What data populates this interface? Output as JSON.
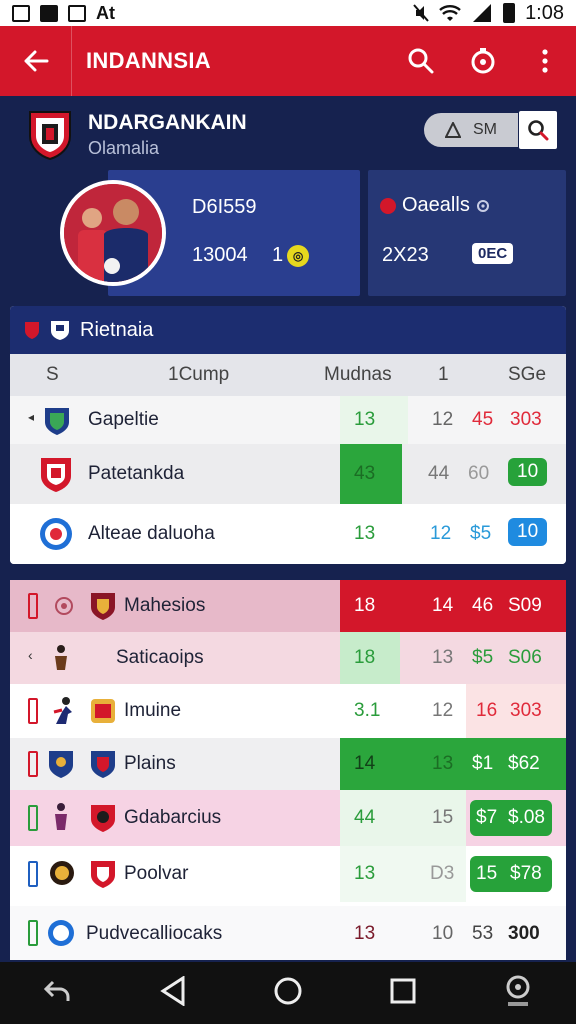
{
  "status_bar": {
    "left_text": "At",
    "time": "1:08"
  },
  "app_bar": {
    "title": "INDANNSIA"
  },
  "team": {
    "name": "NDARGANKAIN",
    "subtitle": "Olamalia",
    "search_label": "SM"
  },
  "player_card": {
    "value_1": "D6I559",
    "value_2": "13004",
    "value_3": "1"
  },
  "side_card": {
    "title": "Oaealls",
    "value": "2X23",
    "tag": "0EC"
  },
  "table1": {
    "title": "Rietnaia",
    "headers": [
      "S",
      "1Cump",
      "Mudnas",
      "1",
      "SGe"
    ],
    "rows": [
      {
        "name": "Gapeltie",
        "pts": "13",
        "c2": "12",
        "c3": "45",
        "c4": "303"
      },
      {
        "name": "Patetankda",
        "pts": "43",
        "c2": "44",
        "c3": "60",
        "c4": "10"
      },
      {
        "name": "Alteae daluoha",
        "pts": "13",
        "c2": "12",
        "c3": "$5",
        "c4": "10"
      }
    ]
  },
  "table2": {
    "rows": [
      {
        "name": "Mahesios",
        "pts": "18",
        "c2": "14",
        "c3": "46",
        "c4": "S09"
      },
      {
        "name": "Saticaoips",
        "pts": "18",
        "c2": "13",
        "c3": "$5",
        "c4": "S06"
      },
      {
        "name": "Imuine",
        "pts": "3.1",
        "c2": "12",
        "c3": "16",
        "c4": "303"
      },
      {
        "name": "Plains",
        "pts": "14",
        "c2": "13",
        "c3": "$1",
        "c4": "$62"
      },
      {
        "name": "Gdabarcius",
        "pts": "44",
        "c2": "15",
        "c3": "$7",
        "c4": "$.08"
      },
      {
        "name": "Poolvar",
        "pts": "13",
        "c2": "D3",
        "c3": "15",
        "c4": "$78"
      },
      {
        "name": "Pudvecalliocaks",
        "pts": "13",
        "c2": "10",
        "c3": "53",
        "c4": "300"
      }
    ]
  },
  "colors": {
    "brand_red": "#d3172a",
    "navy": "#16224f",
    "card_blue": "#2a3e8f",
    "green": "#27a23a",
    "blue_badge": "#1f8be0"
  }
}
